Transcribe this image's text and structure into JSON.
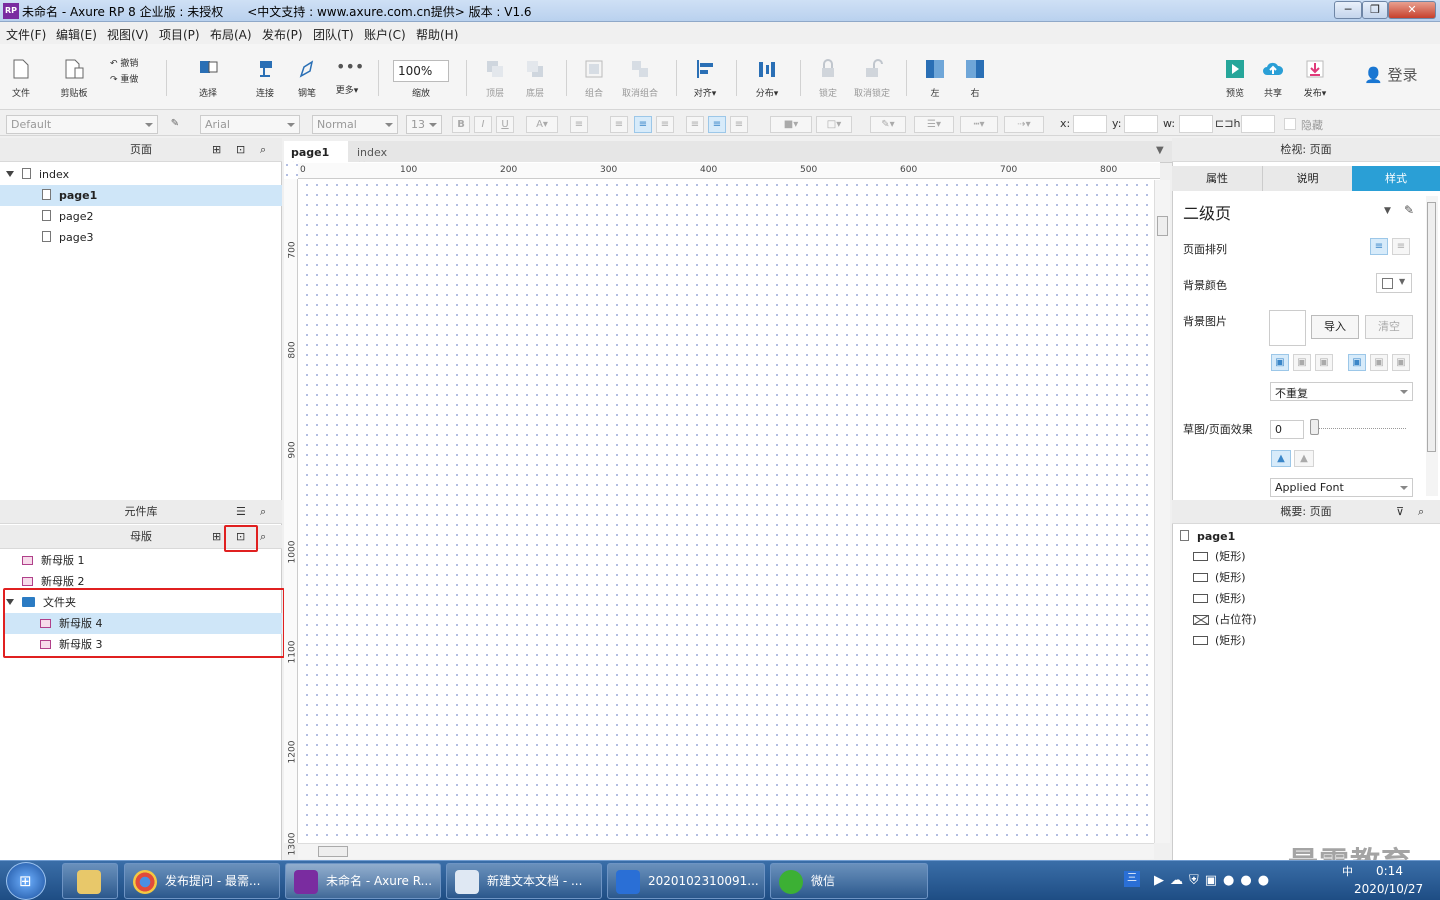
{
  "window": {
    "title": "未命名 - Axure RP 8 企业版 : 未授权　　<中文支持 : www.axure.com.cn提供> 版本 : V1.6",
    "app_icon": "RP"
  },
  "menu": [
    "文件(F)",
    "编辑(E)",
    "视图(V)",
    "项目(P)",
    "布局(A)",
    "发布(P)",
    "团队(T)",
    "账户(C)",
    "帮助(H)"
  ],
  "toolbar": {
    "file": "文件",
    "clipboard": "剪贴板",
    "undo": "撤销",
    "redo": "重做",
    "select": "选择",
    "connect": "连接",
    "pen": "钢笔",
    "more": "更多▾",
    "zoom": "100%",
    "zoom_label": "缩放",
    "top": "顶层",
    "bottom": "底层",
    "group": "组合",
    "ungroup": "取消组合",
    "align": "对齐▾",
    "distribute": "分布▾",
    "lock": "锁定",
    "unlock": "取消锁定",
    "left": "左",
    "right": "右",
    "preview": "预览",
    "share": "共享",
    "publish": "发布▾",
    "login": "登录"
  },
  "format": {
    "style": "Default",
    "font": "Arial",
    "weight": "Normal",
    "size": "13",
    "x": "x:",
    "y": "y:",
    "w": "w:",
    "h": "h:",
    "hide": "隐藏"
  },
  "pages_panel": {
    "title": "页面",
    "root": "index",
    "pages": [
      "page1",
      "page2",
      "page3"
    ],
    "selected": "page1"
  },
  "library_panel": {
    "title": "元件库"
  },
  "masters_panel": {
    "title": "母版",
    "items": [
      "新母版 1",
      "新母版 2"
    ],
    "folder": "文件夹",
    "folder_items": [
      "新母版 4",
      "新母版 3"
    ],
    "selected": "新母版 4"
  },
  "tabs": [
    "page1",
    "index"
  ],
  "ruler": {
    "h": [
      "0",
      "100",
      "200",
      "300",
      "400",
      "500",
      "600",
      "700",
      "800"
    ],
    "v": [
      "700",
      "800",
      "900",
      "1000",
      "1100",
      "1200",
      "1300"
    ]
  },
  "inspector": {
    "title": "检视: 页面",
    "tabs": [
      "属性",
      "说明",
      "样式"
    ],
    "active_tab": "样式",
    "page_style": "二级页",
    "page_align": "页面排列",
    "bg_color": "背景颜色",
    "bg_image": "背景图片",
    "import": "导入",
    "clear": "清空",
    "repeat": "不重复",
    "sketch": "草图/页面效果",
    "sketch_value": "0",
    "applied_font": "Applied Font"
  },
  "outline": {
    "title": "概要: 页面",
    "root": "page1",
    "items": [
      "(矩形)",
      "(矩形)",
      "(矩形)",
      "(占位符)",
      "(矩形)"
    ]
  },
  "taskbar": {
    "items": [
      "发布提问 - 最需...",
      "未命名 - Axure R...",
      "新建文本文档 - ...",
      "2020102310091...",
      "微信"
    ],
    "time": "0:14",
    "date": "2020/10/27",
    "ime": "中"
  },
  "watermark": "最需教育",
  "colors": {
    "accent": "#2a9fd6",
    "red": "#e02020",
    "selection": "#cfe6f8"
  }
}
